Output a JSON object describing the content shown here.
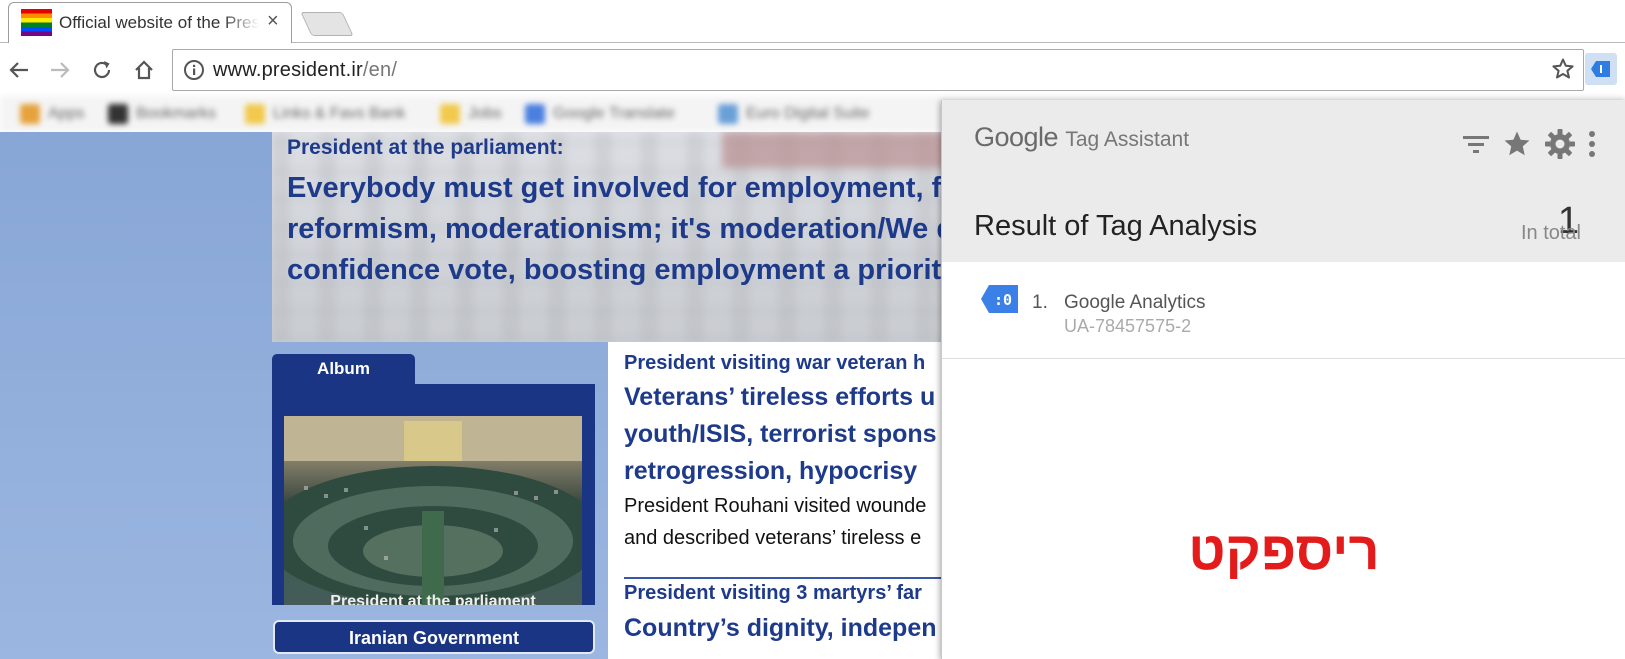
{
  "tab": {
    "title": "Official website of the President",
    "close": "×"
  },
  "toolbar": {
    "url_host": "www.president.ir",
    "url_path": "/en/"
  },
  "bookmarks": [
    "Apps",
    "Bookmarks",
    "Links & Favs Bank",
    "Jobs",
    "Google Translate",
    "Euro Digital Suite"
  ],
  "hero": {
    "kicker": "President at the parliament:",
    "headline": "Everybody must get involved for employment, fundamentalism, reformism, moderationism; it's moderation/We demand decisive confidence vote, boosting employment a priority for gov't"
  },
  "album": {
    "tab_label": "Album",
    "caption": "President at the parliament"
  },
  "government_button": "Iranian Government",
  "news": {
    "item1": {
      "kicker": "President visiting war veteran h",
      "headline_lines": [
        "Veterans’ tireless efforts u",
        "youth/ISIS, terrorist spons",
        "retrogression, hypocrisy"
      ],
      "body_lines": [
        "President Rouhani visited wounde",
        "and described veterans’ tireless e"
      ]
    },
    "item2": {
      "kicker": "President visiting 3 martyrs’ far",
      "headline": "Country’s dignity, indepen"
    }
  },
  "tag_assistant": {
    "brand_google": "Google",
    "brand_product": "Tag Assistant",
    "result_title": "Result of Tag Analysis",
    "count": "1",
    "count_label": "In total",
    "tags": [
      {
        "index": "1.",
        "name": "Google Analytics",
        "id": "UA-78457575-2",
        "badge": ":0"
      }
    ]
  },
  "watermark": "ריספקט"
}
